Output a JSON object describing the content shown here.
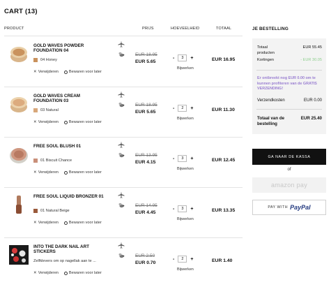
{
  "cart_title": "CART (13)",
  "columns": {
    "product": "PRODUCT",
    "price": "PRIJS",
    "qty": "HOEVEELHEID",
    "total": "TOTAAL"
  },
  "items": [
    {
      "name": "GOLD WAVES POWDER FOUNDATION 04",
      "shade": "04 Honey",
      "shade_color": "#c9915c",
      "old_price": "EUR 18.95",
      "new_price": "EUR 5.65",
      "qty": "3",
      "total": "EUR 16.95"
    },
    {
      "name": "GOLD WAVES CREAM FOUNDATION 03",
      "shade": "03 Natural",
      "shade_color": "#d8a77a",
      "old_price": "EUR 18.95",
      "new_price": "EUR 5.65",
      "qty": "2",
      "total": "EUR 11.30"
    },
    {
      "name": "FREE SOUL BLUSH 01",
      "shade": "01 Biscuit Chance",
      "shade_color": "#c98f79",
      "old_price": "EUR 13.95",
      "new_price": "EUR 4.15",
      "qty": "3",
      "total": "EUR 12.45"
    },
    {
      "name": "FREE SOUL LIQUID BRONZER 01",
      "shade": "01 Natural Beige",
      "shade_color": "#9a5a3b",
      "old_price": "EUR 14.95",
      "new_price": "EUR 4.45",
      "qty": "3",
      "total": "EUR 13.35"
    },
    {
      "name": "INTO THE DARK NAIL ART STICKERS",
      "shade": "Zelfklevers om op nagellak aan te ...",
      "shade_color": "",
      "old_price": "EUR 2.50",
      "new_price": "EUR 0.70",
      "qty": "2",
      "total": "EUR 1.40"
    }
  ],
  "actions": {
    "remove": "Verwijderen",
    "save": "Bewaren voor later",
    "update": "Bijwerken",
    "minus": "-",
    "plus": "+"
  },
  "summary": {
    "title": "JE BESTELLING",
    "total_products_label": "Totaal producten",
    "total_products_value": "EUR 55.45",
    "discounts_label": "Kortingen",
    "discounts_value": "- EUR 30.05",
    "promo_text": "Er ontbreekt nog EUR 0.00 om te kunnen profiteren van de GRATIS VERZENDING!",
    "shipping_label": "Verzendkosten",
    "shipping_value": "EUR 0.00",
    "order_total_label": "Totaal van de bestelling",
    "order_total_value": "EUR 25.40"
  },
  "checkout": {
    "button": "GA NAAR DE KASSA",
    "or": "of",
    "amazon": "amazon pay",
    "paypal_prefix": "PAY WITH",
    "paypal_brand": "PayPal"
  },
  "colors": {
    "discount": "#8fcf8f",
    "promo": "#9a7fd1",
    "paypal_dark": "#253b80",
    "paypal_light": "#179bd7"
  }
}
